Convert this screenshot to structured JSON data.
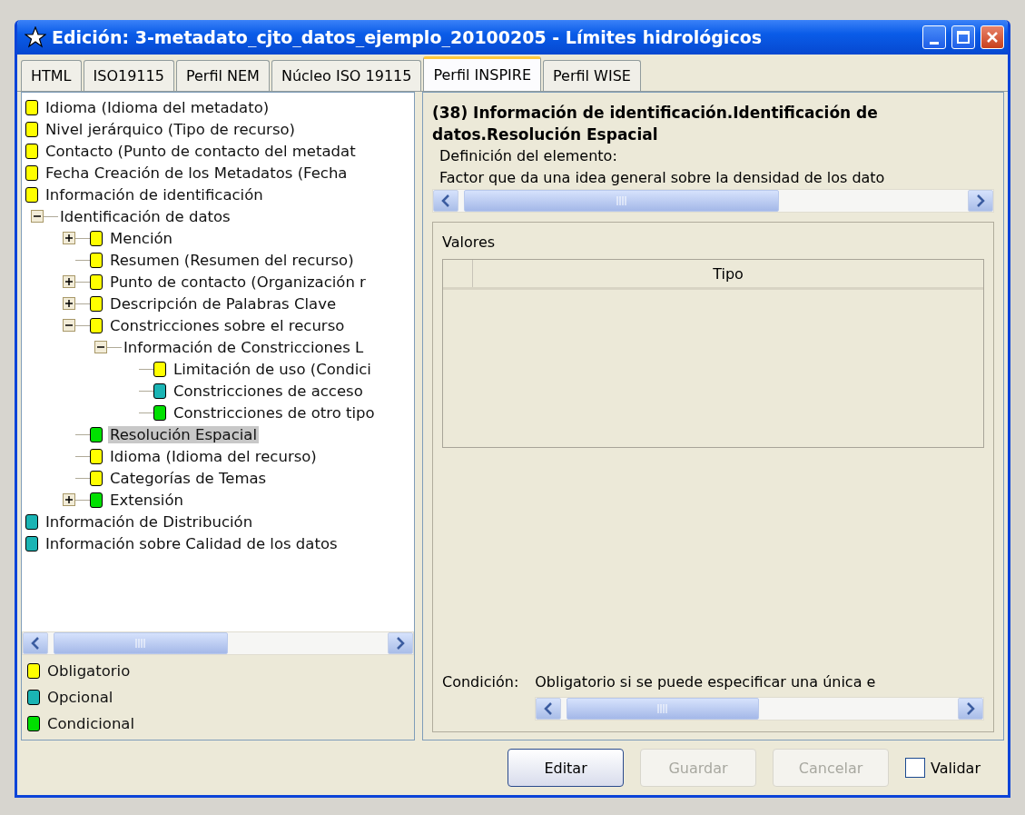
{
  "window": {
    "title": "Edición: 3-metadato_cjto_datos_ejemplo_20100205 - Límites hidrológicos"
  },
  "tabs": [
    {
      "label": "HTML",
      "selected": false
    },
    {
      "label": "ISO19115",
      "selected": false
    },
    {
      "label": "Perfil NEM",
      "selected": false
    },
    {
      "label": "Núcleo ISO 19115",
      "selected": false
    },
    {
      "label": "Perfil INSPIRE",
      "selected": true
    },
    {
      "label": "Perfil WISE",
      "selected": false
    }
  ],
  "tree": [
    {
      "label": "Idioma (Idioma del metadato)",
      "color": "#ffff00",
      "selected": false
    },
    {
      "label": "Nivel jerárquico (Tipo de recurso)",
      "color": "#ffff00",
      "selected": false
    },
    {
      "label": "Contacto (Punto de contacto del metadat",
      "color": "#ffff00",
      "selected": false
    },
    {
      "label": "Fecha Creación de los Metadatos (Fecha",
      "color": "#ffff00",
      "selected": false
    },
    {
      "label": "Información de identificación",
      "color": "#ffff00",
      "selected": false
    },
    {
      "label": "Identificación de datos",
      "selected": false,
      "expanded": true,
      "children": [
        {
          "label": "Mención",
          "color": "#ffff00",
          "selected": false,
          "expanded": false
        },
        {
          "label": "Resumen (Resumen del recurso)",
          "color": "#ffff00",
          "selected": false
        },
        {
          "label": "Punto de contacto (Organización r",
          "color": "#ffff00",
          "selected": false,
          "expanded": false
        },
        {
          "label": "Descripción de Palabras Clave",
          "color": "#ffff00",
          "selected": false,
          "expanded": false
        },
        {
          "label": "Constricciones sobre el recurso",
          "color": "#ffff00",
          "selected": false,
          "expanded": true,
          "children": [
            {
              "label": "Información de Constricciones L",
              "selected": false,
              "expanded": true,
              "children": [
                {
                  "label": "Limitación de uso (Condici",
                  "color": "#ffff00",
                  "selected": false
                },
                {
                  "label": "Constricciones de acceso",
                  "color": "#1ab4b4",
                  "selected": false
                },
                {
                  "label": "Constricciones de otro tipo",
                  "color": "#00e000",
                  "selected": false
                }
              ]
            }
          ]
        },
        {
          "label": "Resolución Espacial",
          "color": "#00e000",
          "selected": true
        },
        {
          "label": "Idioma (Idioma del recurso)",
          "color": "#ffff00",
          "selected": false
        },
        {
          "label": "Categorías de Temas",
          "color": "#ffff00",
          "selected": false
        },
        {
          "label": "Extensión",
          "color": "#00e000",
          "selected": false,
          "expanded": false
        }
      ]
    },
    {
      "label": "Información de Distribución",
      "color": "#1ab4b4",
      "selected": false
    },
    {
      "label": "Información sobre Calidad de los datos",
      "color": "#1ab4b4",
      "selected": false
    }
  ],
  "legend": [
    {
      "label": "Obligatorio",
      "color": "#ffff00"
    },
    {
      "label": "Opcional",
      "color": "#1ab4b4"
    },
    {
      "label": "Condicional",
      "color": "#00e000"
    }
  ],
  "detail": {
    "heading": "(38) Información de identificación.Identificación de datos.Resolución Espacial",
    "definition_label": "Definición del elemento:",
    "definition": "Factor que da una idea general sobre la densidad de los dato",
    "values_label": "Valores",
    "table": {
      "columns": [
        "Tipo"
      ]
    },
    "condition_label": "Condición:",
    "condition": "Obligatorio si se puede especificar una única e"
  },
  "buttons": [
    {
      "label": "Editar",
      "disabled": false
    },
    {
      "label": "Guardar",
      "disabled": true
    },
    {
      "label": "Cancelar",
      "disabled": true
    }
  ],
  "validate": {
    "label": "Validar",
    "checked": false
  }
}
